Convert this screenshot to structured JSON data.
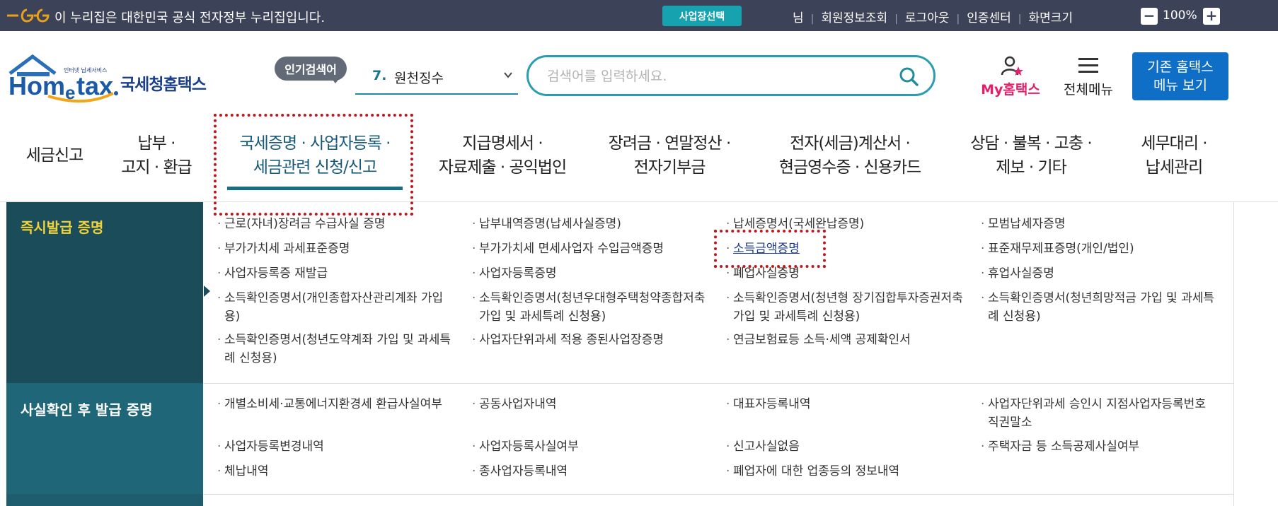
{
  "topbar": {
    "gov_notice": "이 누리집은 대한민국 공식 전자정부 누리집입니다.",
    "business_select": "사업장선택",
    "links": [
      "님",
      "회원정보조회",
      "로그아웃",
      "인증센터",
      "화면크기"
    ],
    "zoom_level": "100%",
    "zoom_minus": "−",
    "zoom_plus": "+"
  },
  "header": {
    "logo_text": "국세청홈택스",
    "popular_badge": "인기검색어",
    "popular_rank": "7.",
    "popular_keyword": "원천징수",
    "search_placeholder": "검색어를 입력하세요.",
    "my_hometax": "My홈택스",
    "all_menu": "전체메뉴",
    "legacy_button": [
      "기존 홈택스",
      "메뉴 보기"
    ]
  },
  "gnb": [
    {
      "line1": "세금신고",
      "line2": ""
    },
    {
      "line1": "납부 ·",
      "line2": "고지 · 환급"
    },
    {
      "line1": "국세증명 · 사업자등록 ·",
      "line2": "세금관련 신청/신고"
    },
    {
      "line1": "지급명세서 ·",
      "line2": "자료제출 · 공익법인"
    },
    {
      "line1": "장려금 · 연말정산 ·",
      "line2": "전자기부금"
    },
    {
      "line1": "전자(세금)계산서 ·",
      "line2": "현금영수증 · 신용카드"
    },
    {
      "line1": "상담 · 불복 · 고충 ·",
      "line2": "제보 · 기타"
    },
    {
      "line1": "세무대리 ·",
      "line2": "납세관리"
    }
  ],
  "menu": {
    "section1": {
      "title": "즉시발급 증명",
      "items": [
        "근로(자녀)장려금 수급사실 증명",
        "납부내역증명(납세사실증명)",
        "납세증명서(국세완납증명)",
        "모범납세자증명",
        "부가가치세 과세표준증명",
        "부가가치세 면세사업자 수입금액증명",
        "소득금액증명",
        "표준재무제표증명(개인/법인)",
        "사업자등록증 재발급",
        "사업자등록증명",
        "폐업사실증명",
        "휴업사실증명",
        "소득확인증명서(개인종합자산관리계좌 가입용)",
        "소득확인증명서(청년우대형주택청약종합저축 가입 및 과세특례 신청용)",
        "소득확인증명서(청년형 장기집합투자증권저축 가입 및 과세특례 신청용)",
        "소득확인증명서(청년희망적금 가입 및 과세특례 신청용)",
        "소득확인증명서(청년도약계좌 가입 및 과세특례 신청용)",
        "사업자단위과세 적용 종된사업장증명",
        "연금보험료등 소득·세액 공제확인서"
      ]
    },
    "section2": {
      "title": "사실확인 후 발급 증명",
      "items": [
        "개별소비세·교통에너지환경세 환급사실여부",
        "공동사업자내역",
        "대표자등록내역",
        "사업자단위과세 승인시 지점사업자등록번호 직권말소",
        "사업자등록변경내역",
        "사업자등록사실여부",
        "신고사실없음",
        "주택자금 등 소득공제사실여부",
        "체납내역",
        "종사업자등록내역",
        "폐업자에 대한 업종등의 정보내역"
      ]
    }
  },
  "colors": {
    "topbar_bg": "#3c4257",
    "accent_teal": "#17a2b0",
    "highlight_red": "#c0171c",
    "category_dark": "#1a4c5a",
    "category_title_yellow": "#f1d23b",
    "legacy_button_bg": "#0f6fc6",
    "my_hometax_pink": "#e2206c"
  }
}
